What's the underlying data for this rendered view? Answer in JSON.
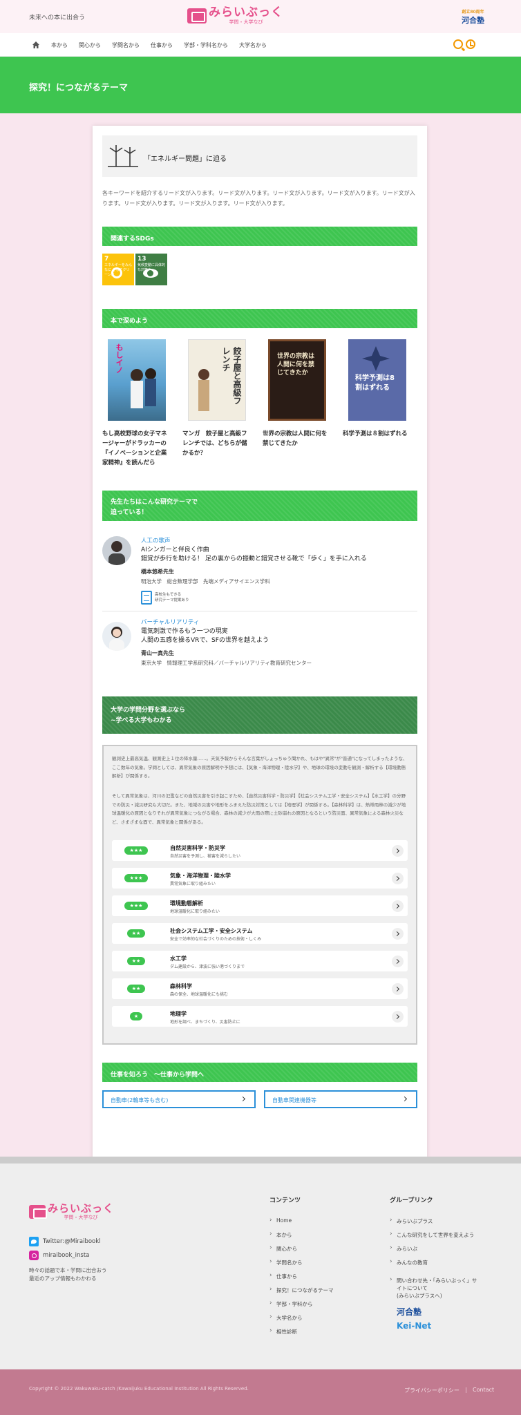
{
  "header": {
    "tagline": "未来への本に出合う",
    "logo_name": "みらいぶっく",
    "logo_sub": "学問・大学なび",
    "partner_top": "創立80周年",
    "partner_name": "河合塾"
  },
  "nav": {
    "items": [
      "本から",
      "関心から",
      "学問名から",
      "仕事から",
      "学部・学科名から",
      "大学名から"
    ]
  },
  "hero": {
    "title": "探究！につながるテーマ"
  },
  "theme": {
    "title": "「エネルギー問題」に迫る",
    "description": "各キーワードを紹介するリード文が入ります。リード文が入ります。リード文が入ります。リード文が入ります。リード文が入ります。リード文が入ります。リード文が入ります。リード文が入ります。"
  },
  "sdgs": {
    "heading": "関連するSDGs",
    "items": [
      {
        "num": "7",
        "label": "エネルギーをみんなに そしてクリーンに",
        "color": "#fcc30b"
      },
      {
        "num": "13",
        "label": "気候変動に具体的な対策を",
        "color": "#3f7e44"
      }
    ]
  },
  "books": {
    "heading": "本で深めよう",
    "items": [
      {
        "title": "もし高校野球の女子マネージャーがドラッカーの『イノベーションと企業家精神』を読んだら",
        "cover_text": "もしイノ"
      },
      {
        "title": "マンガ　餃子屋と高級フレンチでは、どちらが儲かるか？",
        "cover_text": "餃子屋と高級フレンチ"
      },
      {
        "title": "世界の宗教は人間に何を禁じてきたか",
        "cover_text": "世界の宗教は人間に何を禁じてきたか"
      },
      {
        "title": "科学予測は８割はずれる",
        "cover_text": "科学予測は8割はずれる"
      }
    ]
  },
  "research": {
    "heading_line1": "先生たちはこんな研究テーマで",
    "heading_line2": "迫っている！",
    "teachers": [
      {
        "category": "人工の歌声",
        "topic_line1": "AIシンガーと伴良く作曲",
        "topic_line2": "錯覚が歩行を助ける！ 足の裏からの振動と錯覚させる靴で「歩く」を手に入れる",
        "name": "橋本悠希先生",
        "affiliation": "明治大学　総合数理学部　先端メディアサイエンス学科",
        "doc_label_line1": "高校生もできる",
        "doc_label_line2": "研究テーマ提案あり"
      },
      {
        "category": "バーチャルリアリティ",
        "topic_line1": "電気刺激で作るもう一つの現実",
        "topic_line2": "人間の五感を操るVRで、SFの世界を越えよう",
        "name": "青山一真先生",
        "affiliation": "東京大学　情報理工学系研究科／バーチャルリアリティ教育研究センター"
      }
    ]
  },
  "fields": {
    "heading_line1": "大学の学問分野を選ぶなら",
    "heading_line2": "~学べる大学もわかる",
    "intro1": "観測史上最高気温、観測史上１位の降水量……。天気予報からそんな言葉がしょっちゅう聞かれ、もはや\"異常\"が\"普通\"になってしまったような、ここ数年の気象。学問としては、異常気象の原因解明や予想には、【気象・海洋物理・陸水学】や、地球の環境の変動を観測・解析する【環境動態解析】が関係する。",
    "intro2": "そして異常気象は、河川の氾濫などの自然災害を引き起こすため、【自然災害科学・防災学】【社会システム工学・安全システム】【水工学】の分野での防災・減災研究も大切だ。また、地域の災害や地形をふまえた防災対策としては【地理学】が関係する。【森林科学】は、熱帯雨林の減少が地球温暖化の原因となりそれが異常気象につながる場合、森林の減少が大雨の際に土砂崩れの原因となるという防災面、異常気象による森林火災など、さまざまな面で、異常気象と関係がある。",
    "items": [
      {
        "stars": "★★★",
        "name": "自然災害科学・防災学",
        "desc": "自然災害を予測し、被害を減らしたい"
      },
      {
        "stars": "★★★",
        "name": "気象・海洋物理・陸水学",
        "desc": "異常気象に取り組みたい"
      },
      {
        "stars": "★★★",
        "name": "環境動態解析",
        "desc": "地球温暖化に取り組みたい"
      },
      {
        "stars": "★★",
        "name": "社会システム工学・安全システム",
        "desc": "安全で効率的な社会づくりのための技術・しくみ"
      },
      {
        "stars": "★★",
        "name": "水工学",
        "desc": "ダム建設から、津波に強い港づくりまで"
      },
      {
        "stars": "★★",
        "name": "森林科学",
        "desc": "森の保全、地球温暖化にも挑む"
      },
      {
        "stars": "★",
        "name": "地理学",
        "desc": "地形を調べ、まちづくり、災害防止に"
      }
    ]
  },
  "jobs": {
    "heading": "仕事を知ろう　～仕事から学問へ",
    "items": [
      "自動車(2輪車等も含む)",
      "自動車関連機器等"
    ]
  },
  "footer": {
    "logo_name": "みらいぶっく",
    "logo_sub": "学問・大学なび",
    "twitter": "Twitter:@Miraibookl",
    "instagram": "miraibook_insta",
    "note1": "時々の話題で本・学問に出合おう",
    "note2": "最近のアップ情報もわかわる",
    "contents_heading": "コンテンツ",
    "contents": [
      "Home",
      "本から",
      "関心から",
      "学問名から",
      "仕事から",
      "探究！につながるテーマ",
      "学部・学科から",
      "大学名から",
      "相性診断"
    ],
    "group_heading": "グループリンク",
    "group": [
      "みらいぶプラス",
      "こんな研究をして世界を変えよう",
      "みらいぶ",
      "みんなの教育"
    ],
    "inquiry_line1": "問い合わせ先・「みらいぶっく」サ",
    "inquiry_line2": "イトについて",
    "inquiry_line3": "(みらいぶプラスへ)",
    "kawai": "河合塾",
    "keinet": "Kei-Net",
    "copyright": "Copyright © 2022 Wakuwaku-catch /Kawaijuku Educational Institution All Rights Reserved.",
    "privacy": "プライバシーポリシー",
    "contact": "Contact"
  }
}
